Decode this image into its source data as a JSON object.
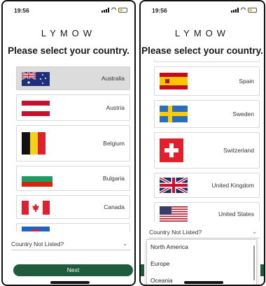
{
  "status_bar": {
    "time": "19:56"
  },
  "app": {
    "logo": "LYMOW",
    "title": "Please select your country."
  },
  "left_screen": {
    "countries": [
      {
        "name": "Australia",
        "flag": "au-flag-icon",
        "selected": true
      },
      {
        "name": "Austria",
        "flag": "at-flag-icon",
        "selected": false
      },
      {
        "name": "Belgium",
        "flag": "be-flag-icon",
        "selected": false
      },
      {
        "name": "Bulgaria",
        "flag": "bg-flag-icon",
        "selected": false
      },
      {
        "name": "Canada",
        "flag": "ca-flag-icon",
        "selected": false
      }
    ],
    "not_listed_select": {
      "value": "Country Not Listed?"
    },
    "next_button": "Next"
  },
  "right_screen": {
    "countries": [
      {
        "name": "Spain",
        "flag": "es-flag-icon"
      },
      {
        "name": "Sweden",
        "flag": "se-flag-icon"
      },
      {
        "name": "Switzerland",
        "flag": "ch-flag-icon"
      },
      {
        "name": "United Kingdom",
        "flag": "gb-flag-icon"
      },
      {
        "name": "United States",
        "flag": "us-flag-icon"
      }
    ],
    "not_listed_select": {
      "value": "Country Not Listed?"
    },
    "dropdown_options": [
      "North America",
      "Europe",
      "Oceania"
    ]
  },
  "colors": {
    "primary": "#1e5c3d",
    "selected_row": "#dcdcdc"
  }
}
